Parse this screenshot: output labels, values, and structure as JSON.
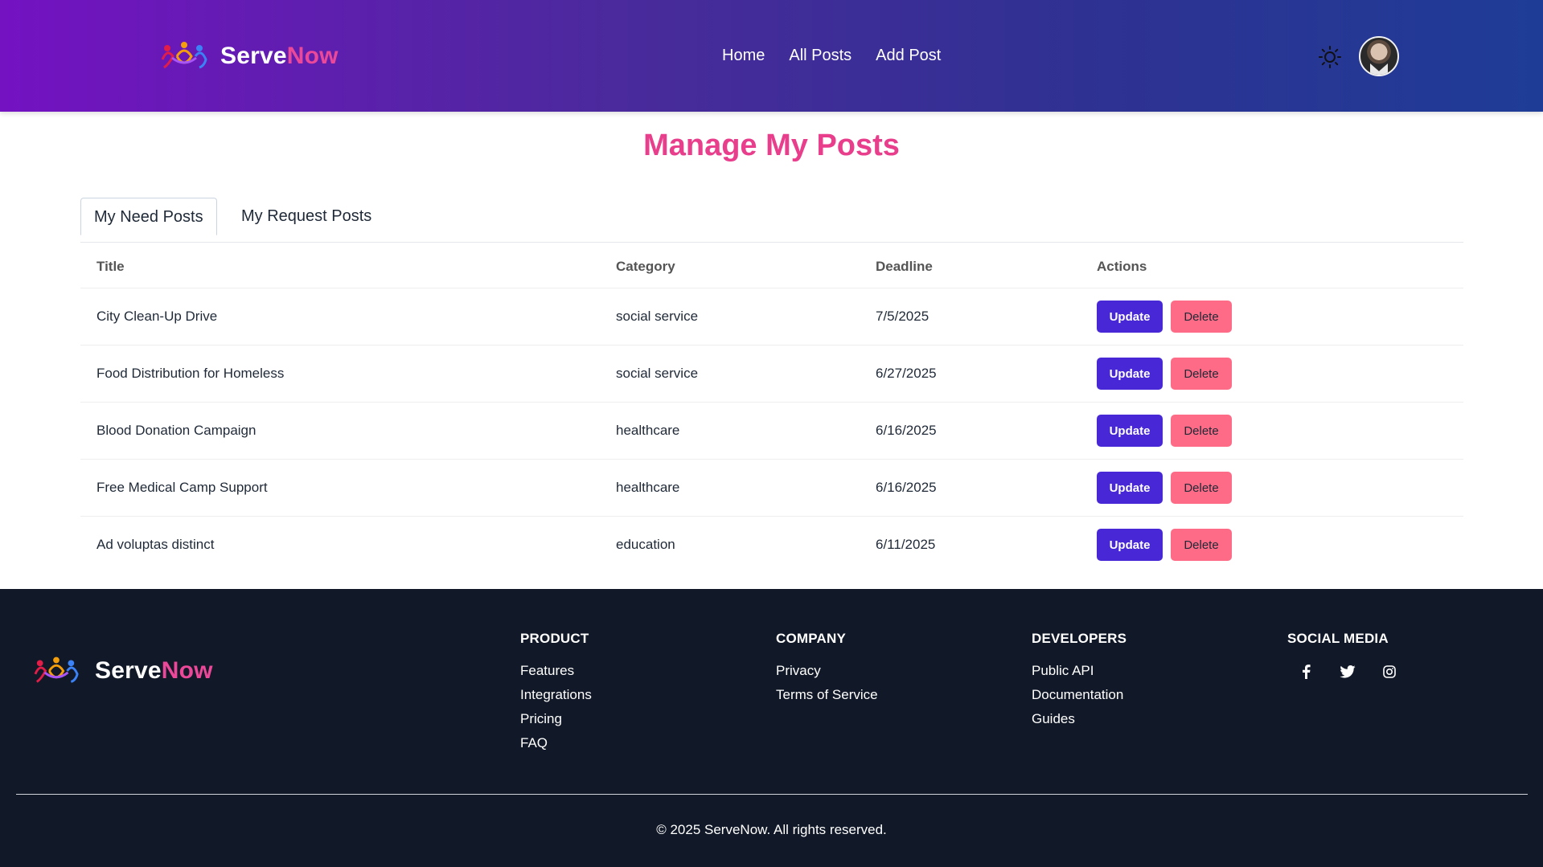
{
  "header": {
    "brand": {
      "part1": "Serve",
      "part2": "Now"
    },
    "nav": [
      "Home",
      "All Posts",
      "Add Post"
    ],
    "icons": {
      "theme_toggle": "sun-icon",
      "avatar": "user-avatar"
    }
  },
  "main": {
    "title": "Manage My Posts",
    "tabs": [
      {
        "label": "My Need Posts",
        "active": true
      },
      {
        "label": "My Request Posts",
        "active": false
      }
    ],
    "table": {
      "headers": [
        "Title",
        "Category",
        "Deadline",
        "Actions"
      ],
      "rows": [
        {
          "title": "City Clean-Up Drive",
          "category": "social service",
          "deadline": "7/5/2025"
        },
        {
          "title": "Food Distribution for Homeless",
          "category": "social service",
          "deadline": "6/27/2025"
        },
        {
          "title": "Blood Donation Campaign",
          "category": "healthcare",
          "deadline": "6/16/2025"
        },
        {
          "title": "Free Medical Camp Support",
          "category": "healthcare",
          "deadline": "6/16/2025"
        },
        {
          "title": "Ad voluptas distinct",
          "category": "education",
          "deadline": "6/11/2025"
        }
      ],
      "update_label": "Update",
      "delete_label": "Delete"
    }
  },
  "footer": {
    "brand": {
      "part1": "Serve",
      "part2": "Now"
    },
    "columns": [
      {
        "heading": "PRODUCT",
        "links": [
          "Features",
          "Integrations",
          "Pricing",
          "FAQ"
        ]
      },
      {
        "heading": "COMPANY",
        "links": [
          "Privacy",
          "Terms of Service"
        ]
      },
      {
        "heading": "DEVELOPERS",
        "links": [
          "Public API",
          "Documentation",
          "Guides"
        ]
      }
    ],
    "social_heading": "SOCIAL MEDIA",
    "social_icons": [
      "facebook-icon",
      "twitter-icon",
      "instagram-icon"
    ],
    "copyright": "© 2025 ServeNow. All rights reserved."
  },
  "colors": {
    "accent_pink": "#e83e8c",
    "update_button": "#4727d6",
    "delete_button": "#fe6b86",
    "footer_bg": "#111827"
  }
}
